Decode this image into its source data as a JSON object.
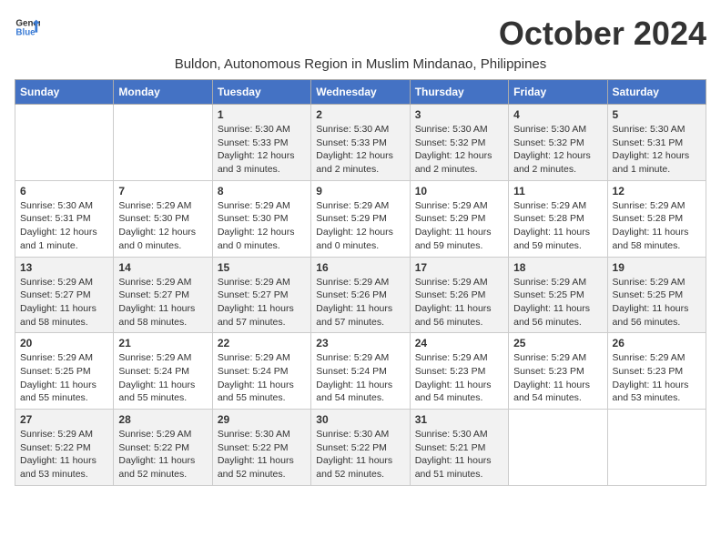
{
  "logo": {
    "general": "General",
    "blue": "Blue"
  },
  "title": "October 2024",
  "location": "Buldon, Autonomous Region in Muslim Mindanao, Philippines",
  "days_header": [
    "Sunday",
    "Monday",
    "Tuesday",
    "Wednesday",
    "Thursday",
    "Friday",
    "Saturday"
  ],
  "weeks": [
    [
      {
        "day": "",
        "sunrise": "",
        "sunset": "",
        "daylight": ""
      },
      {
        "day": "",
        "sunrise": "",
        "sunset": "",
        "daylight": ""
      },
      {
        "day": "1",
        "sunrise": "Sunrise: 5:30 AM",
        "sunset": "Sunset: 5:33 PM",
        "daylight": "Daylight: 12 hours and 3 minutes."
      },
      {
        "day": "2",
        "sunrise": "Sunrise: 5:30 AM",
        "sunset": "Sunset: 5:33 PM",
        "daylight": "Daylight: 12 hours and 2 minutes."
      },
      {
        "day": "3",
        "sunrise": "Sunrise: 5:30 AM",
        "sunset": "Sunset: 5:32 PM",
        "daylight": "Daylight: 12 hours and 2 minutes."
      },
      {
        "day": "4",
        "sunrise": "Sunrise: 5:30 AM",
        "sunset": "Sunset: 5:32 PM",
        "daylight": "Daylight: 12 hours and 2 minutes."
      },
      {
        "day": "5",
        "sunrise": "Sunrise: 5:30 AM",
        "sunset": "Sunset: 5:31 PM",
        "daylight": "Daylight: 12 hours and 1 minute."
      }
    ],
    [
      {
        "day": "6",
        "sunrise": "Sunrise: 5:30 AM",
        "sunset": "Sunset: 5:31 PM",
        "daylight": "Daylight: 12 hours and 1 minute."
      },
      {
        "day": "7",
        "sunrise": "Sunrise: 5:29 AM",
        "sunset": "Sunset: 5:30 PM",
        "daylight": "Daylight: 12 hours and 0 minutes."
      },
      {
        "day": "8",
        "sunrise": "Sunrise: 5:29 AM",
        "sunset": "Sunset: 5:30 PM",
        "daylight": "Daylight: 12 hours and 0 minutes."
      },
      {
        "day": "9",
        "sunrise": "Sunrise: 5:29 AM",
        "sunset": "Sunset: 5:29 PM",
        "daylight": "Daylight: 12 hours and 0 minutes."
      },
      {
        "day": "10",
        "sunrise": "Sunrise: 5:29 AM",
        "sunset": "Sunset: 5:29 PM",
        "daylight": "Daylight: 11 hours and 59 minutes."
      },
      {
        "day": "11",
        "sunrise": "Sunrise: 5:29 AM",
        "sunset": "Sunset: 5:28 PM",
        "daylight": "Daylight: 11 hours and 59 minutes."
      },
      {
        "day": "12",
        "sunrise": "Sunrise: 5:29 AM",
        "sunset": "Sunset: 5:28 PM",
        "daylight": "Daylight: 11 hours and 58 minutes."
      }
    ],
    [
      {
        "day": "13",
        "sunrise": "Sunrise: 5:29 AM",
        "sunset": "Sunset: 5:27 PM",
        "daylight": "Daylight: 11 hours and 58 minutes."
      },
      {
        "day": "14",
        "sunrise": "Sunrise: 5:29 AM",
        "sunset": "Sunset: 5:27 PM",
        "daylight": "Daylight: 11 hours and 58 minutes."
      },
      {
        "day": "15",
        "sunrise": "Sunrise: 5:29 AM",
        "sunset": "Sunset: 5:27 PM",
        "daylight": "Daylight: 11 hours and 57 minutes."
      },
      {
        "day": "16",
        "sunrise": "Sunrise: 5:29 AM",
        "sunset": "Sunset: 5:26 PM",
        "daylight": "Daylight: 11 hours and 57 minutes."
      },
      {
        "day": "17",
        "sunrise": "Sunrise: 5:29 AM",
        "sunset": "Sunset: 5:26 PM",
        "daylight": "Daylight: 11 hours and 56 minutes."
      },
      {
        "day": "18",
        "sunrise": "Sunrise: 5:29 AM",
        "sunset": "Sunset: 5:25 PM",
        "daylight": "Daylight: 11 hours and 56 minutes."
      },
      {
        "day": "19",
        "sunrise": "Sunrise: 5:29 AM",
        "sunset": "Sunset: 5:25 PM",
        "daylight": "Daylight: 11 hours and 56 minutes."
      }
    ],
    [
      {
        "day": "20",
        "sunrise": "Sunrise: 5:29 AM",
        "sunset": "Sunset: 5:25 PM",
        "daylight": "Daylight: 11 hours and 55 minutes."
      },
      {
        "day": "21",
        "sunrise": "Sunrise: 5:29 AM",
        "sunset": "Sunset: 5:24 PM",
        "daylight": "Daylight: 11 hours and 55 minutes."
      },
      {
        "day": "22",
        "sunrise": "Sunrise: 5:29 AM",
        "sunset": "Sunset: 5:24 PM",
        "daylight": "Daylight: 11 hours and 55 minutes."
      },
      {
        "day": "23",
        "sunrise": "Sunrise: 5:29 AM",
        "sunset": "Sunset: 5:24 PM",
        "daylight": "Daylight: 11 hours and 54 minutes."
      },
      {
        "day": "24",
        "sunrise": "Sunrise: 5:29 AM",
        "sunset": "Sunset: 5:23 PM",
        "daylight": "Daylight: 11 hours and 54 minutes."
      },
      {
        "day": "25",
        "sunrise": "Sunrise: 5:29 AM",
        "sunset": "Sunset: 5:23 PM",
        "daylight": "Daylight: 11 hours and 54 minutes."
      },
      {
        "day": "26",
        "sunrise": "Sunrise: 5:29 AM",
        "sunset": "Sunset: 5:23 PM",
        "daylight": "Daylight: 11 hours and 53 minutes."
      }
    ],
    [
      {
        "day": "27",
        "sunrise": "Sunrise: 5:29 AM",
        "sunset": "Sunset: 5:22 PM",
        "daylight": "Daylight: 11 hours and 53 minutes."
      },
      {
        "day": "28",
        "sunrise": "Sunrise: 5:29 AM",
        "sunset": "Sunset: 5:22 PM",
        "daylight": "Daylight: 11 hours and 52 minutes."
      },
      {
        "day": "29",
        "sunrise": "Sunrise: 5:30 AM",
        "sunset": "Sunset: 5:22 PM",
        "daylight": "Daylight: 11 hours and 52 minutes."
      },
      {
        "day": "30",
        "sunrise": "Sunrise: 5:30 AM",
        "sunset": "Sunset: 5:22 PM",
        "daylight": "Daylight: 11 hours and 52 minutes."
      },
      {
        "day": "31",
        "sunrise": "Sunrise: 5:30 AM",
        "sunset": "Sunset: 5:21 PM",
        "daylight": "Daylight: 11 hours and 51 minutes."
      },
      {
        "day": "",
        "sunrise": "",
        "sunset": "",
        "daylight": ""
      },
      {
        "day": "",
        "sunrise": "",
        "sunset": "",
        "daylight": ""
      }
    ]
  ]
}
